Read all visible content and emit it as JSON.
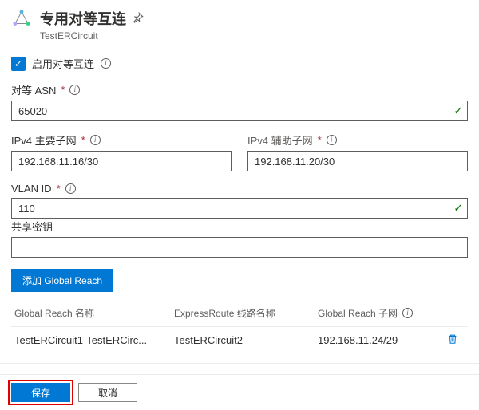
{
  "header": {
    "title": "专用对等互连",
    "subtitle": "TestERCircuit"
  },
  "enable": {
    "label": "启用对等互连"
  },
  "fields": {
    "peer_asn": {
      "label": "对等 ASN",
      "value": "65020"
    },
    "ipv4_primary": {
      "label": "IPv4 主要子网",
      "value": "192.168.11.16/30"
    },
    "ipv4_secondary": {
      "label": "IPv4 辅助子网",
      "value": "192.168.11.20/30"
    },
    "vlan_id": {
      "label": "VLAN ID",
      "value": "110"
    },
    "shared_key": {
      "label": "共享密钥",
      "value": ""
    }
  },
  "add_button": "添加 Global Reach",
  "table": {
    "headers": {
      "name": "Global  Reach 名称",
      "circuit": "ExpressRoute 线路名称",
      "subnet": "Global Reach 子网"
    },
    "row": {
      "name": "TestERCircuit1-TestERCirc...",
      "circuit": "TestERCircuit2",
      "subnet": "192.168.11.24/29"
    }
  },
  "footer": {
    "save": "保存",
    "cancel": "取消"
  }
}
